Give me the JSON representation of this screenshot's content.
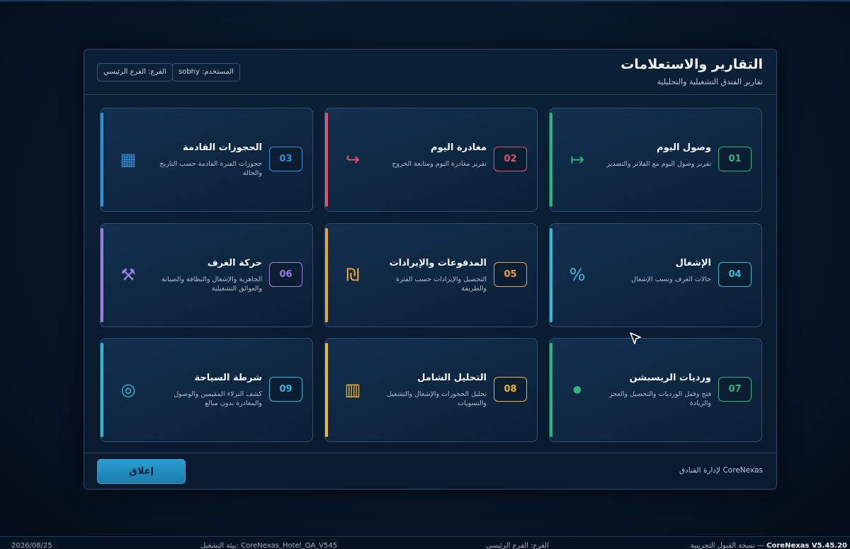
{
  "dialog": {
    "title": "التقارير والاستعلامات",
    "subtitle": "تقارير الفندق التشغيلية والتحليلية",
    "user_chip": "المستخدم: sobhy",
    "branch_chip": "الفرع: الفرع الرئيسي",
    "footer_note": "CoreNexas لإدارة الفنادق",
    "close_label": "إغلاق"
  },
  "cards": [
    {
      "num": "01",
      "title": "وصول اليوم",
      "desc": "تقرير وصول اليوم مع الفلاتر والتصدير",
      "icon": "arrow-to-bar-icon",
      "glyph": "↦",
      "color": "#2fb37a"
    },
    {
      "num": "02",
      "title": "مغادرة اليوم",
      "desc": "تقرير مغادرة اليوم ومتابعة الخروج",
      "icon": "return-arrow-icon",
      "glyph": "↪",
      "color": "#e05468"
    },
    {
      "num": "03",
      "title": "الحجوزات القادمة",
      "desc": "حجوزات الفترة القادمة حسب التاريخ والحالة",
      "icon": "grid-icon",
      "glyph": "▦",
      "color": "#2f8fd4"
    },
    {
      "num": "04",
      "title": "الإشغال",
      "desc": "حالات الغرف ونسب الإشغال",
      "icon": "percent-icon",
      "glyph": "%",
      "color": "#3ab7d8"
    },
    {
      "num": "05",
      "title": "المدفوعات والإيرادات",
      "desc": "التحصيل والإيرادات حسب الفترة والطريقة",
      "icon": "shekel-icon",
      "glyph": "₪",
      "color": "#e9a43a"
    },
    {
      "num": "06",
      "title": "حركة الغرف",
      "desc": "الجاهزية والإشغال والنظافة والصيانة والعوائق التشغيلية",
      "icon": "hammer-pick-icon",
      "glyph": "⚒",
      "color": "#9b7fe0"
    },
    {
      "num": "07",
      "title": "ورديات الريسبشن",
      "desc": "فتح وقفل الورديات والتحصيل والعجز والزيادة",
      "icon": "dot-icon",
      "glyph": "●",
      "color": "#2fb37a"
    },
    {
      "num": "08",
      "title": "التحليل الشامل",
      "desc": "تحليل الحجوزات والإشغال والتشغيل والتسويات",
      "icon": "bars-icon",
      "glyph": "▥",
      "color": "#e9b43a"
    },
    {
      "num": "09",
      "title": "شرطة السياحة",
      "desc": "كشف النزلاء المقيمين والوصول والمغادرة بدون مبالغ",
      "icon": "target-icon",
      "glyph": "◎",
      "color": "#36b6d6"
    }
  ],
  "statusbar": {
    "date": "2026/08/25",
    "env": "بيئة التشغيل: CoreNexas_Hotel_QA_V545",
    "branch": "الفرع: الفرع الرئيسي",
    "app_name": "CoreNexas V5.45.20",
    "app_note": "— نسخة القبول التجريبية"
  }
}
